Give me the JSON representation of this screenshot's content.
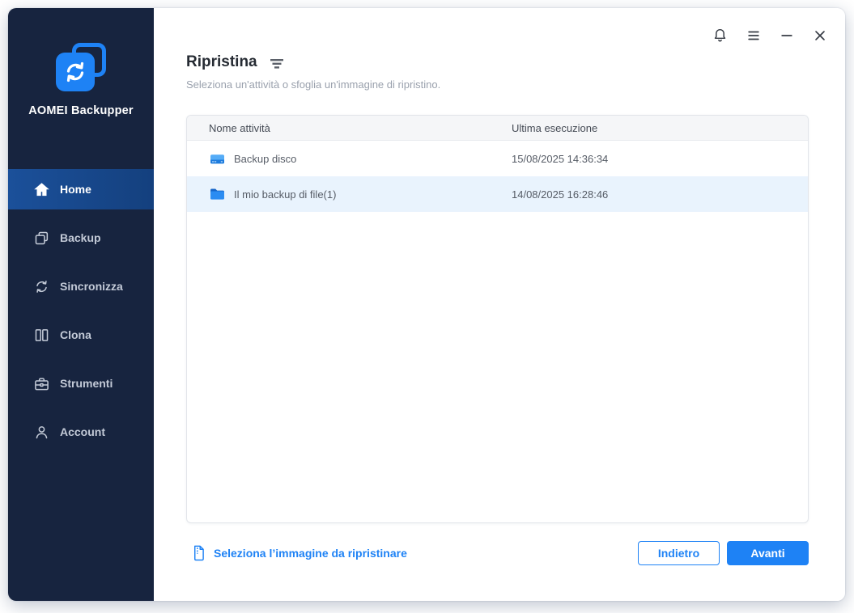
{
  "window": {
    "app_title": "AOMEI Backupper"
  },
  "titlebar": {
    "icons": [
      "notification-bell-icon",
      "menu-icon",
      "minimize-icon",
      "close-icon"
    ]
  },
  "sidebar": {
    "app_name": "AOMEI Backupper",
    "logo_icon": "sync-arrows-icon",
    "items": [
      {
        "label": "Home",
        "icon": "home",
        "active": true
      },
      {
        "label": "Backup",
        "icon": "backup",
        "active": false
      },
      {
        "label": "Sincronizza",
        "icon": "sync",
        "active": false
      },
      {
        "label": "Clona",
        "icon": "clone",
        "active": false
      },
      {
        "label": "Strumenti",
        "icon": "tools",
        "active": false
      },
      {
        "label": "Account",
        "icon": "account",
        "active": false
      }
    ]
  },
  "header": {
    "title": "Ripristina",
    "filter_icon": "filter-icon",
    "subtitle": "Seleziona un'attività o sfoglia un'immagine di ripristino."
  },
  "table": {
    "columns": [
      "Nome attività",
      "Ultima esecuzione"
    ],
    "rows": [
      {
        "icon": "disk",
        "name": "Backup disco",
        "last_run": "15/08/2025 14:36:34",
        "selected": false
      },
      {
        "icon": "folder",
        "name": "Il mio backup di file(1)",
        "last_run": "14/08/2025 16:28:46",
        "selected": true
      }
    ]
  },
  "footer": {
    "browse_icon": "image-file-icon",
    "browse_image_label": "Seleziona l’immagine da ripristinare",
    "back_button": "Indietro",
    "next_button": "Avanti"
  },
  "colors": {
    "accent": "#1E82F5",
    "sidebar_bg": "#17243F",
    "active_item_bg": "#164A8C",
    "selected_row_bg": "#E9F3FD",
    "table_header_bg": "#F5F6F8"
  }
}
